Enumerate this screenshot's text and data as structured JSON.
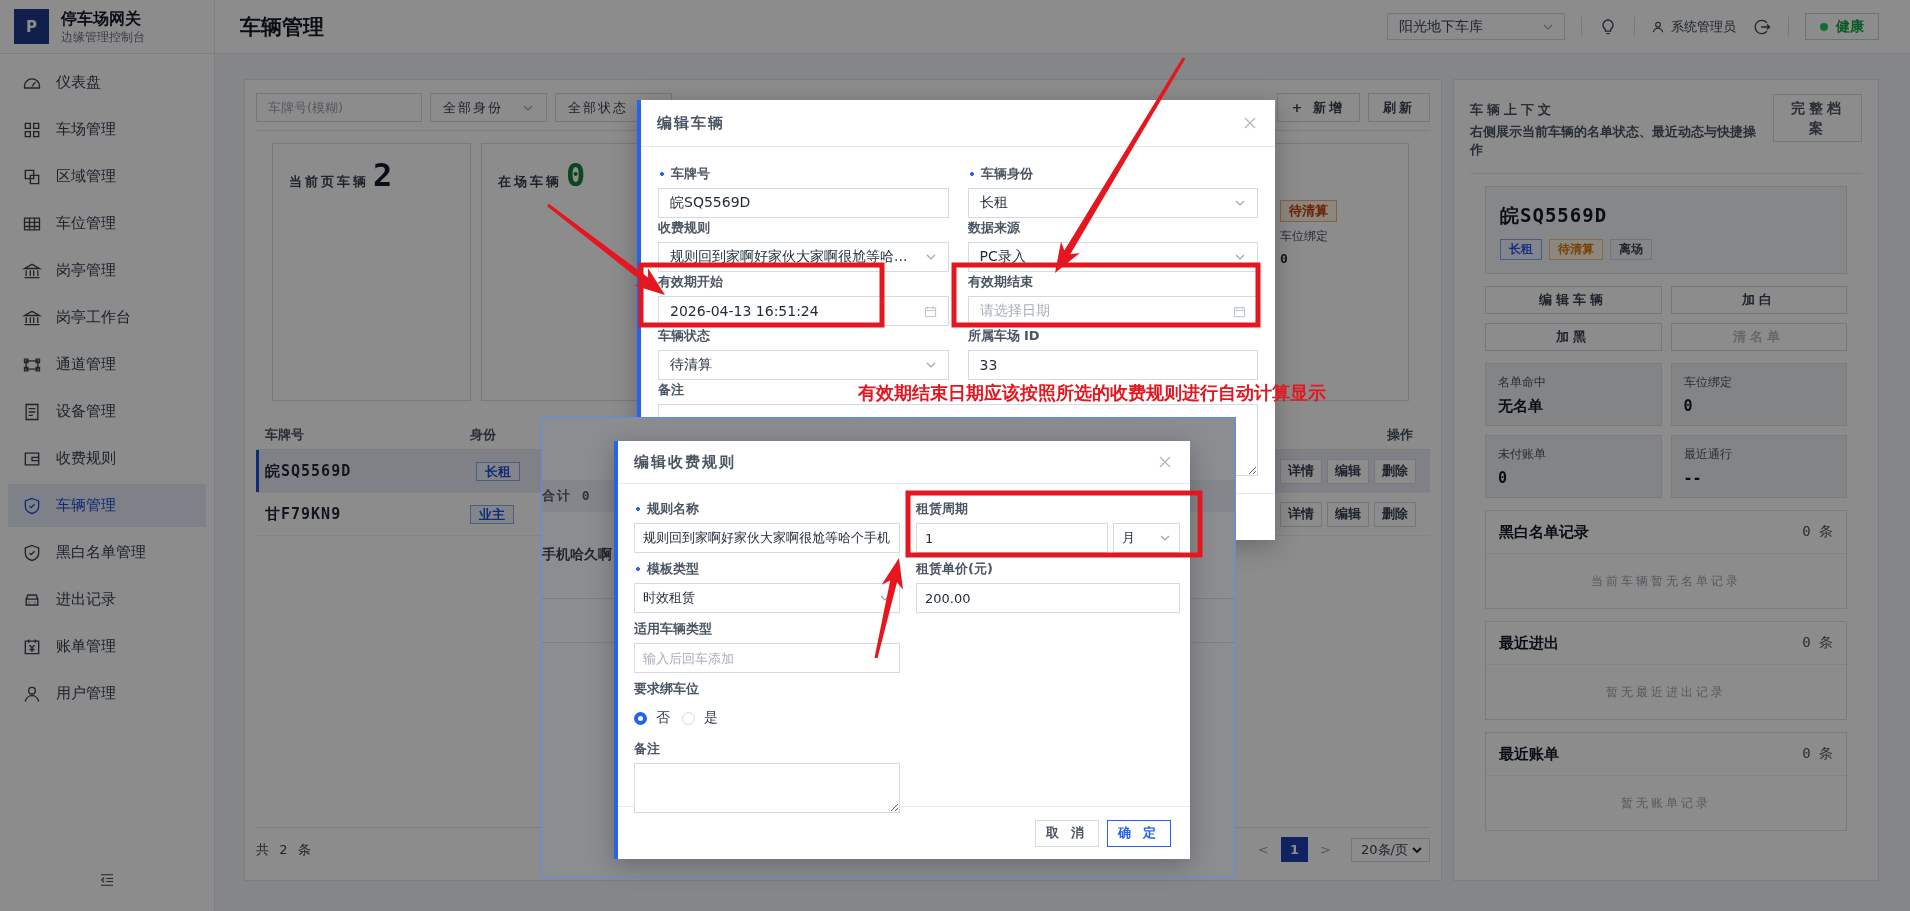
{
  "sidebar": {
    "logo": "P",
    "title": "停车场网关",
    "subtitle": "边缘管理控制台",
    "items": [
      {
        "label": "仪表盘",
        "selected": false
      },
      {
        "label": "车场管理",
        "selected": false
      },
      {
        "label": "区域管理",
        "selected": false
      },
      {
        "label": "车位管理",
        "selected": false
      },
      {
        "label": "岗亭管理",
        "selected": false
      },
      {
        "label": "岗亭工作台",
        "selected": false
      },
      {
        "label": "通道管理",
        "selected": false
      },
      {
        "label": "设备管理",
        "selected": false
      },
      {
        "label": "收费规则",
        "selected": false
      },
      {
        "label": "车辆管理",
        "selected": true
      },
      {
        "label": "黑白名单管理",
        "selected": false
      },
      {
        "label": "进出记录",
        "selected": false
      },
      {
        "label": "账单管理",
        "selected": false
      },
      {
        "label": "用户管理",
        "selected": false
      }
    ]
  },
  "header": {
    "title": "车辆管理",
    "lot": "阳光地下车库",
    "user": "系统管理员",
    "health": "健康"
  },
  "toolbar": {
    "search_placeholder": "车牌号(模糊)",
    "identity_filter": "全部身份",
    "status_filter": "全部状态",
    "add_button": "+ 新增",
    "refresh_button": "刷新"
  },
  "stats": [
    {
      "label": "当前页车辆",
      "value": "2",
      "kind": "count"
    },
    {
      "label": "在场车辆",
      "value": "0",
      "kind": "present"
    }
  ],
  "stat_card_3": {
    "tag": "待清算",
    "label": "车位绑定",
    "value": "0"
  },
  "table": {
    "columns": [
      "车牌号",
      "身份",
      "操作"
    ],
    "rows": [
      {
        "plate": "皖SQ5569D",
        "identity": "长租",
        "selected": true,
        "actions": [
          "详情",
          "编辑",
          "删除"
        ]
      },
      {
        "plate": "甘F79KN9",
        "identity": "业主",
        "selected": false,
        "actions": [
          "详情",
          "编辑",
          "删除"
        ]
      }
    ],
    "total": "共 2 条",
    "prev": "<",
    "pages": [
      {
        "label": "1",
        "selected": true
      }
    ],
    "next": ">",
    "page_size": "20条/页"
  },
  "context_panel": {
    "title": "车辆上下文",
    "description": "右侧展示当前车辆的名单状态、最近动态与快捷操作",
    "archive_button": "完整档案",
    "plate": "皖SQ5569D",
    "tags": [
      {
        "label": "长租",
        "kind": "identity"
      },
      {
        "label": "待清算",
        "kind": "pending"
      },
      {
        "label": "离场",
        "kind": "presence"
      }
    ],
    "actions": [
      {
        "label": "编辑车辆",
        "disabled": false
      },
      {
        "label": "加白",
        "disabled": false
      },
      {
        "label": "加黑",
        "disabled": false
      },
      {
        "label": "清名单",
        "disabled": true
      }
    ],
    "facts": [
      {
        "label": "名单命中",
        "value": "无名单"
      },
      {
        "label": "车位绑定",
        "value": "0"
      },
      {
        "label": "未付账单",
        "value": "0"
      },
      {
        "label": "最近通行",
        "value": "--"
      }
    ],
    "sections": [
      {
        "title": "黑白名单记录",
        "count": "0 条",
        "empty": "当前车辆暂无名单记录"
      },
      {
        "title": "最近进出",
        "count": "0 条",
        "empty": "暂无最近进出记录"
      },
      {
        "title": "最近账单",
        "count": "0 条",
        "empty": "暂无账单记录"
      }
    ]
  },
  "vehicle_dialog": {
    "title": "编辑车辆",
    "rows": [
      [
        {
          "label": "车牌号",
          "required": true,
          "kind": "input",
          "value": "皖SQ5569D"
        },
        {
          "label": "车辆身份",
          "required": true,
          "kind": "select",
          "value": "长租"
        }
      ],
      [
        {
          "label": "收费规则",
          "required": false,
          "kind": "select",
          "value": "规则回到家啊好家伙大家啊很尬等哈..."
        },
        {
          "label": "数据来源",
          "required": false,
          "kind": "select",
          "value": "PC录入"
        }
      ],
      [
        {
          "label": "有效期开始",
          "required": false,
          "kind": "date",
          "value": "2026-04-13 16:51:24"
        },
        {
          "label": "有效期结束",
          "required": false,
          "kind": "date",
          "placeholder": "请选择日期"
        }
      ],
      [
        {
          "label": "车辆状态",
          "required": false,
          "kind": "select",
          "value": "待清算"
        },
        {
          "label": "所属车场 ID",
          "required": false,
          "kind": "input",
          "value": "33"
        }
      ],
      [
        {
          "label": "备注",
          "required": false,
          "kind": "textarea"
        }
      ]
    ]
  },
  "background_list": {
    "summary": "合计 0",
    "name": "手机哈久啊"
  },
  "rule_dialog": {
    "title": "编辑收费规则",
    "rows": [
      [
        {
          "label": "规则名称",
          "required": true,
          "kind": "input",
          "value": "规则回到家啊好家伙大家啊很尬等哈个手机"
        },
        {
          "label": "租赁周期",
          "required": false,
          "kind": "period",
          "value": "1",
          "unit": "月"
        }
      ],
      [
        {
          "label": "模板类型",
          "required": true,
          "kind": "select",
          "value": "时效租赁"
        },
        {
          "label": "租赁单价(元)",
          "required": false,
          "kind": "input",
          "value": "200.00"
        }
      ],
      [
        {
          "label": "适用车辆类型",
          "required": false,
          "kind": "input",
          "placeholder": "输入后回车添加"
        }
      ],
      [
        {
          "label": "要求绑车位",
          "required": false,
          "kind": "radio",
          "options": [
            {
              "label": "否",
              "selected": true
            },
            {
              "label": "是",
              "selected": false
            }
          ]
        }
      ],
      [
        {
          "label": "备注",
          "required": false,
          "kind": "textarea"
        }
      ]
    ],
    "buttons": [
      {
        "label": "取 消",
        "kind": "default"
      },
      {
        "label": "确 定",
        "kind": "primary"
      }
    ]
  },
  "annotation": {
    "note": "有效期结束日期应该按照所选的收费规则进行自动计算显示"
  }
}
